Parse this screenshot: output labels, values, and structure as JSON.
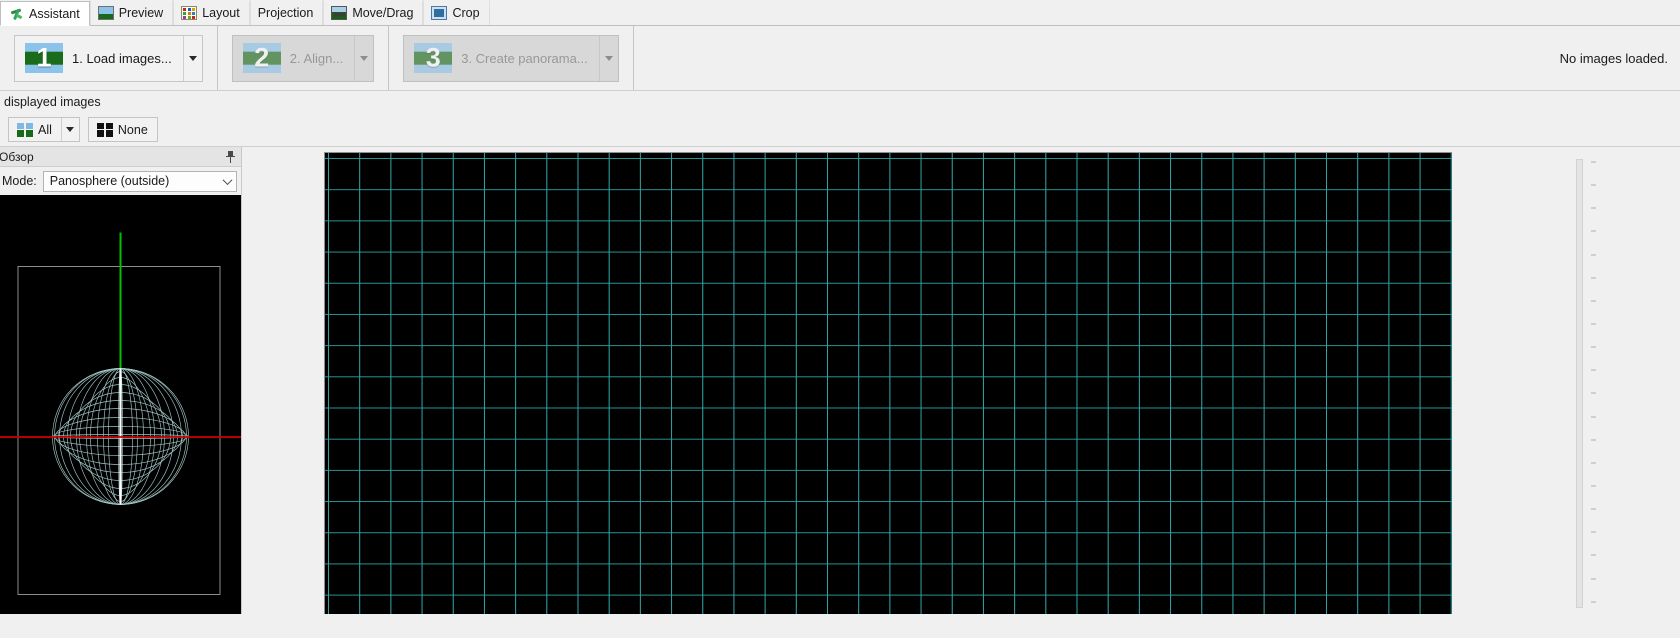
{
  "tabs": [
    {
      "label": "Assistant",
      "icon": "assistant-wand-icon",
      "active": true
    },
    {
      "label": "Preview",
      "icon": "landscape-gl-icon",
      "active": false
    },
    {
      "label": "Layout",
      "icon": "layout-grid-icon",
      "active": false
    },
    {
      "label": "Projection",
      "icon": "none",
      "active": false
    },
    {
      "label": "Move/Drag",
      "icon": "move-drag-icon",
      "active": false
    },
    {
      "label": "Crop",
      "icon": "crop-icon",
      "active": false
    }
  ],
  "toolbar": {
    "steps": [
      {
        "number": "1",
        "label": "1. Load images...",
        "enabled": true
      },
      {
        "number": "2",
        "label": "2. Align...",
        "enabled": false
      },
      {
        "number": "3",
        "label": "3. Create panorama...",
        "enabled": false
      }
    ],
    "status": "No images loaded."
  },
  "displayed": {
    "caption": "displayed images",
    "all_label": "All",
    "none_label": "None"
  },
  "left_panel": {
    "title": "Обзор",
    "mode_label": "Mode:",
    "mode_value": "Panosphere (outside)"
  },
  "colors": {
    "grid_line": "#2b9c9c",
    "sphere_wire": "#bfe9e9",
    "axis_vertical": "#00c000",
    "axis_horizontal": "#d00000",
    "meridian": "#ffffff",
    "canvas_bg": "#000000",
    "chrome_bg": "#f0f0f0",
    "step_sky": "#8cc3ea",
    "step_ground": "#1a6b1a"
  }
}
